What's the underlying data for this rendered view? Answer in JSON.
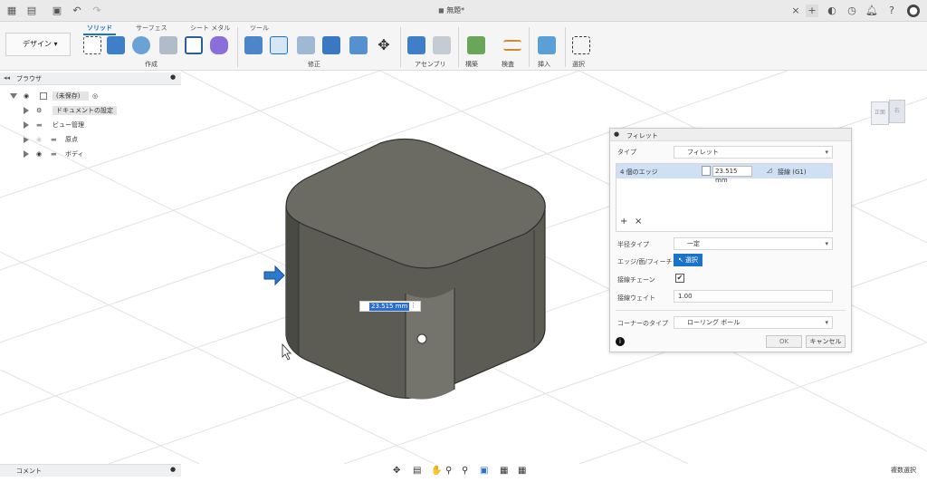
{
  "titlebar": {
    "doc_title": "無題*"
  },
  "ribbon": {
    "workspace": "デザイン",
    "tabs": [
      "ソリッド",
      "サーフェス",
      "シート メタル",
      "ツール"
    ],
    "groups": [
      "作成",
      "修正",
      "アセンブリ",
      "構築",
      "検査",
      "挿入",
      "選択"
    ]
  },
  "browser": {
    "title": "ブラウザ",
    "items": [
      {
        "label": "(未保存)"
      },
      {
        "label": "ドキュメントの設定"
      },
      {
        "label": "ビュー管理"
      },
      {
        "label": "原点"
      },
      {
        "label": "ボディ"
      }
    ]
  },
  "comments": {
    "title": "コメント"
  },
  "viewcube": {
    "front": "正面",
    "right": "右"
  },
  "dimension": {
    "value": "23.515 mm"
  },
  "fillet": {
    "title": "フィレット",
    "type_label": "タイプ",
    "type_value": "フィレット",
    "edges_label": "4 個のエッジ",
    "radius_value": "23.515 mm",
    "tangent_value": "接線 (G1)",
    "radius_type_label": "半径タイプ",
    "radius_type_value": "一定",
    "edge_face_label": "エッジ/面/フィーチャ",
    "select_btn": "選択",
    "tangent_chain_label": "接線チェーン",
    "tangent_weight_label": "接線ウェイト",
    "tangent_weight_value": "1.00",
    "corner_type_label": "コーナーのタイプ",
    "corner_type_value": "ローリング ボール",
    "ok": "OK",
    "cancel": "キャンセル"
  },
  "status": {
    "right": "複数選択"
  },
  "colors": {
    "accent": "#1a72c9",
    "body": "#5f5f58",
    "top": "#6b6b63"
  }
}
